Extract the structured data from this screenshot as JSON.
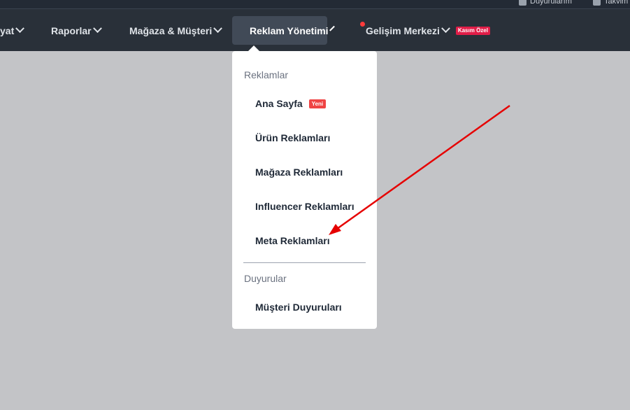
{
  "topbar": {
    "link1_label": "Duyurularım",
    "link2_label": "Takvim"
  },
  "nav": {
    "items": [
      {
        "label": "yat"
      },
      {
        "label": "Raporlar"
      },
      {
        "label": "Mağaza & Müşteri"
      },
      {
        "label": "Reklam Yönetimi"
      },
      {
        "label": "Gelişim Merkezi",
        "badge": "Kasım Özel"
      }
    ]
  },
  "dropdown": {
    "section1_title": "Reklamlar",
    "items": [
      {
        "label": "Ana Sayfa",
        "badge": "Yeni"
      },
      {
        "label": "Ürün Reklamları"
      },
      {
        "label": "Mağaza Reklamları"
      },
      {
        "label": "Influencer Reklamları"
      },
      {
        "label": "Meta Reklamları"
      }
    ],
    "section2_title": "Duyurular",
    "section2_items": [
      {
        "label": "Müşteri Duyuruları"
      }
    ]
  },
  "colors": {
    "navbar_bg": "#293039",
    "active_tab_bg": "#414a57",
    "badge_red": "#e11d48",
    "arrow_red": "#e60000"
  }
}
